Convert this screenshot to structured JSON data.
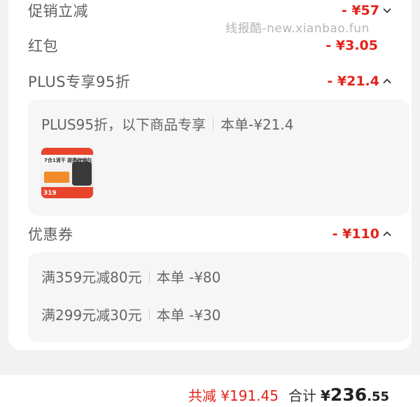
{
  "rows": {
    "promo": {
      "label": "促销立减",
      "amount": "- ¥57"
    },
    "redpacket": {
      "label": "红包",
      "amount": "- ¥3.05"
    },
    "plus": {
      "label": "PLUS专享95折",
      "amount": "- ¥21.4"
    },
    "coupon": {
      "label": "优惠券",
      "amount": "- ¥110"
    }
  },
  "watermark": "线报酷-new.xianbao.fun",
  "plus_panel": {
    "desc": "PLUS95折，以下商品专享",
    "saving": "本单-¥21.4",
    "product_thumb": {
      "headline": "7合1清干 提携收储包",
      "price": "319"
    }
  },
  "coupon_panel": {
    "items": [
      {
        "rule": "满359元减80元",
        "saving": "本单 -¥80"
      },
      {
        "rule": "满299元减30元",
        "saving": "本单 -¥30"
      }
    ]
  },
  "footer": {
    "saved": "共减 ¥191.45",
    "total_label": "合计",
    "currency": "¥",
    "total_int": "236",
    "total_dec": ".55"
  },
  "colors": {
    "accent": "#e2231a",
    "panel": "#f6f6f6",
    "background": "#f2f2f2"
  },
  "icons": {
    "promo": "chevron-down-icon",
    "plus": "chevron-up-icon",
    "coupon": "chevron-up-icon"
  }
}
